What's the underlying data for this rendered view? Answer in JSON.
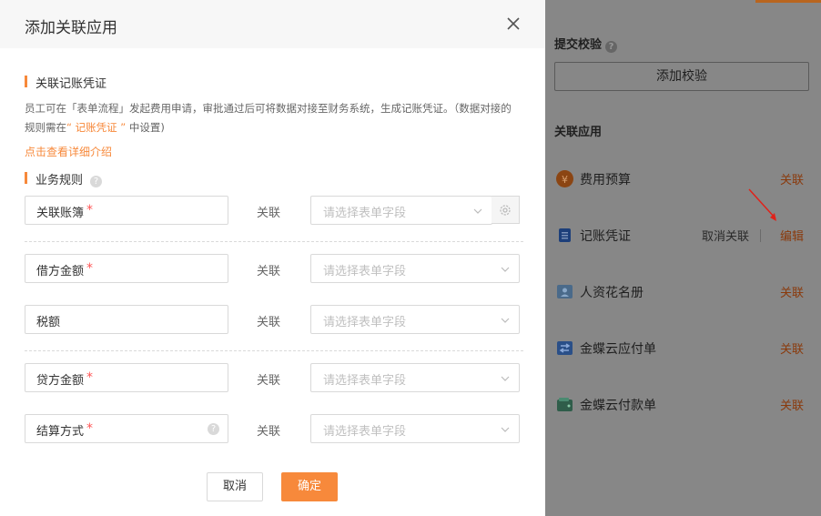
{
  "modal": {
    "title": "添加关联应用",
    "section1_title": "关联记账凭证",
    "desc_part1": "员工可在「表单流程」发起费用申请，审批通过后可将数据对接至财务系统，生成记账凭证。（数据对接的规则需在",
    "desc_highlight": "“ 记账凭证 ”",
    "desc_part2": " 中设置)",
    "detail_link": "点击查看详细介绍",
    "section2_title": "业务规则",
    "help_glyph": "?",
    "relation_label": "关联",
    "select_placeholder": "请选择表单字段",
    "fields": [
      {
        "label": "关联账簿",
        "required": true
      },
      {
        "label": "借方金额",
        "required": true
      },
      {
        "label": "税额",
        "required": false
      },
      {
        "label": "贷方金额",
        "required": true
      },
      {
        "label": "结算方式",
        "required": true
      }
    ],
    "required_mark": "*",
    "cancel_label": "取消",
    "confirm_label": "确定"
  },
  "background": {
    "submit_check_title": "提交校验",
    "add_check_button": "添加校验",
    "linked_apps_title": "关联应用",
    "apps": [
      {
        "name": "费用预算",
        "action": "关联",
        "icon": "yen-coin-icon",
        "color": "#8b4513"
      },
      {
        "name": "记账凭证",
        "action": "编辑",
        "secondary_action": "取消关联",
        "icon": "voucher-list-icon",
        "color": "#1d3f7a"
      },
      {
        "name": "人资花名册",
        "action": "关联",
        "icon": "person-card-icon",
        "color": "#4a6a8a"
      },
      {
        "name": "金蝶云应付单",
        "action": "关联",
        "icon": "transfer-arrows-icon",
        "color": "#2a4f88"
      },
      {
        "name": "金蝶云付款单",
        "action": "关联",
        "icon": "wallet-icon",
        "color": "#2f5d4a"
      }
    ]
  },
  "colors": {
    "accent": "#f7893b",
    "required": "#ff5555",
    "arrow": "#e0221a"
  }
}
